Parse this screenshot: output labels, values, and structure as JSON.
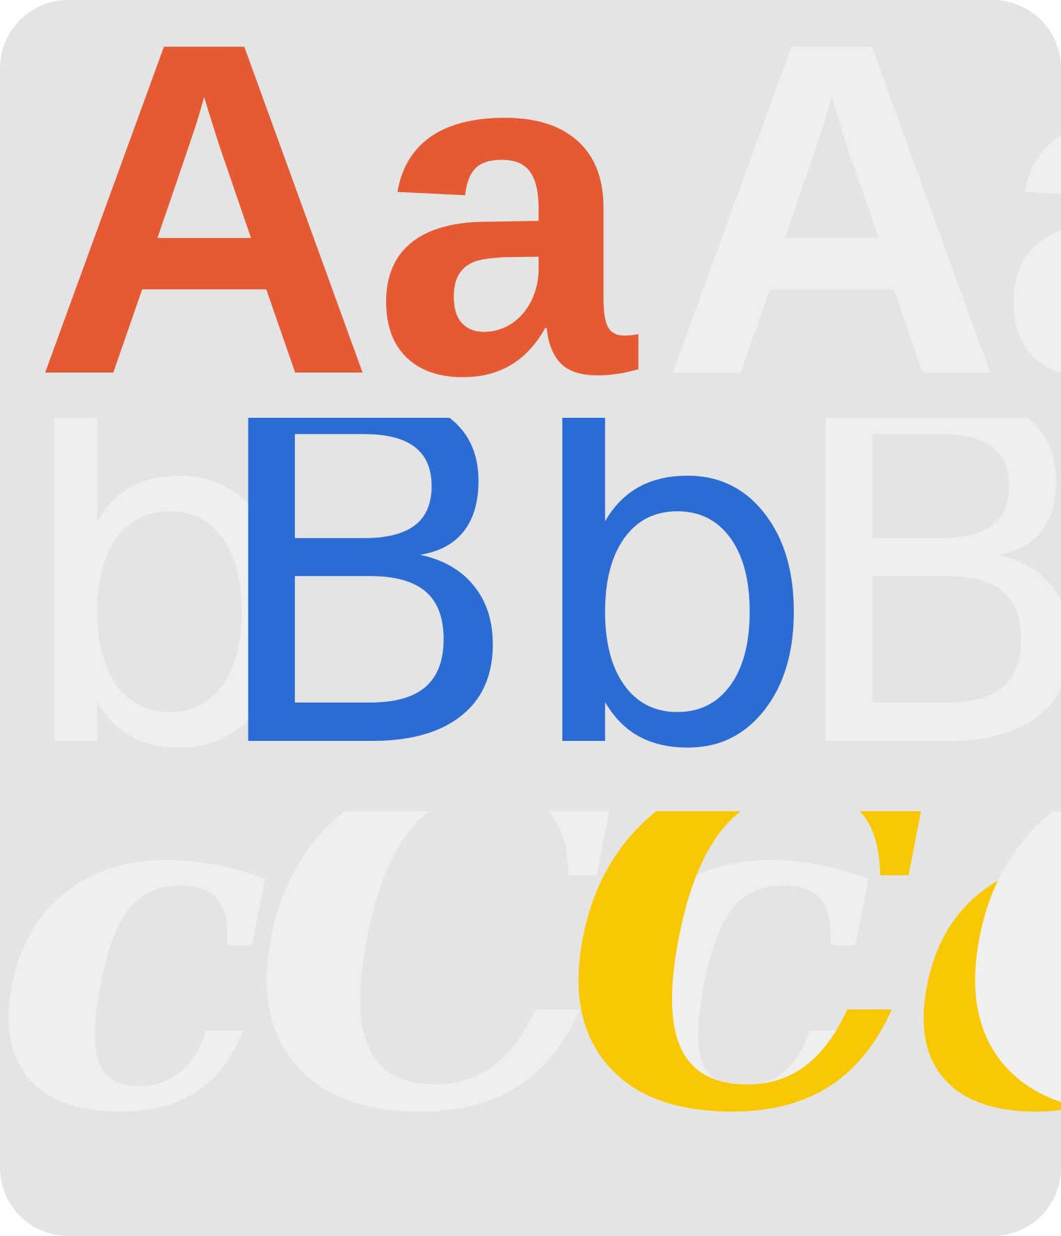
{
  "colors": {
    "background": "#e4e4e4",
    "ghost": "#efefef",
    "a_accent": "#e55a33",
    "b_accent": "#2b6bd4",
    "c_accent": "#f9c805"
  },
  "rows": {
    "a": {
      "ghost_left": "",
      "accent": "Aa",
      "ghost_right": "Aa"
    },
    "b": {
      "ghost_left": "Bb",
      "accent": "Bb",
      "ghost_right": "Bb"
    },
    "c": {
      "ghost_left": "cCc",
      "accent": "Cc",
      "ghost_right": "Cc"
    }
  }
}
